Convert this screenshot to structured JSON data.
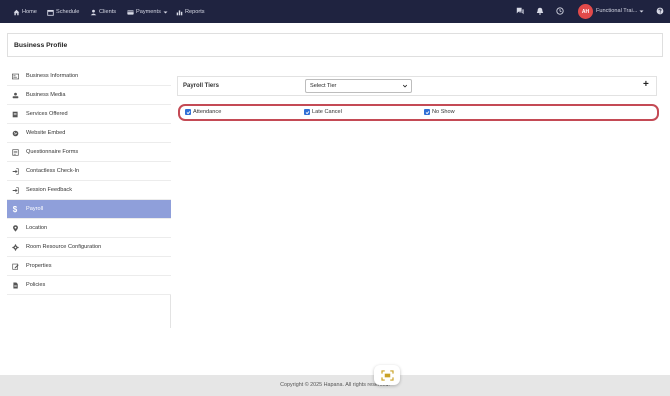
{
  "nav": {
    "items": [
      {
        "label": "Home",
        "icon": "home-icon"
      },
      {
        "label": "Schedule",
        "icon": "calendar-icon"
      },
      {
        "label": "Clients",
        "icon": "user-icon"
      },
      {
        "label": "Payments",
        "icon": "credit-card-icon"
      },
      {
        "label": "Reports",
        "icon": "bar-chart-icon"
      }
    ],
    "right_icons": [
      "chat-icon",
      "bell-icon",
      "clock-icon",
      "help-icon"
    ],
    "avatar_initials": "AH",
    "user_name": "Functional Trai..."
  },
  "header": {
    "title": "Business Profile"
  },
  "sidebar": {
    "items": [
      {
        "label": "Business Information",
        "icon": "id-card-icon"
      },
      {
        "label": "Business Media",
        "icon": "media-icon"
      },
      {
        "label": "Services Offered",
        "icon": "list-icon"
      },
      {
        "label": "Website Embed",
        "icon": "globe-icon"
      },
      {
        "label": "Questionnaire Forms",
        "icon": "form-icon"
      },
      {
        "label": "Contactless Check-In",
        "icon": "sign-in-icon"
      },
      {
        "label": "Session Feedback",
        "icon": "sign-in-icon"
      },
      {
        "label": "Payroll",
        "icon": "dollar-icon",
        "active": true
      },
      {
        "label": "Location",
        "icon": "map-pin-icon"
      },
      {
        "label": "Room Resource Configuration",
        "icon": "gear-icon"
      },
      {
        "label": "Properties",
        "icon": "edit-icon"
      },
      {
        "label": "Policies",
        "icon": "document-icon"
      }
    ]
  },
  "payroll": {
    "tiers_label": "Payroll Tiers",
    "select_value": "Select Tier",
    "add_symbol": "+",
    "checks": [
      {
        "label": "Attendance",
        "checked": true
      },
      {
        "label": "Late Cancel",
        "checked": true
      },
      {
        "label": "No Show",
        "checked": true
      }
    ]
  },
  "footer": {
    "copyright": "Copyright © 2025 Hapana. All rights reserved."
  },
  "colors": {
    "nav_bg": "#1f2340",
    "active_item": "#8f9fda",
    "highlight_border": "#c44a55",
    "checkbox": "#2f6fd6",
    "avatar": "#e24a4a"
  }
}
